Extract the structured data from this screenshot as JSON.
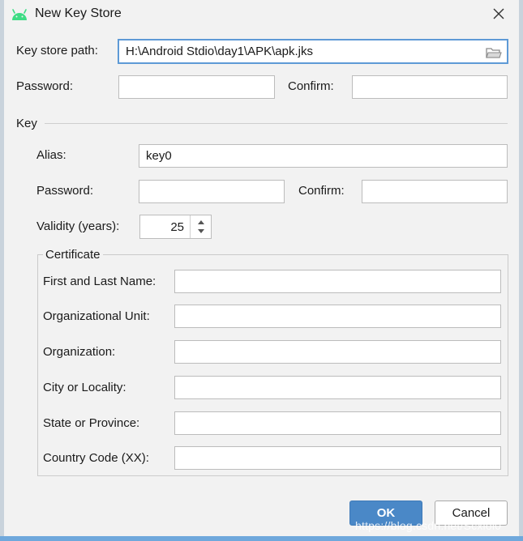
{
  "window": {
    "title": "New Key Store",
    "title_icon": "android-icon",
    "close_icon": "close-icon"
  },
  "keystore": {
    "path_label": "Key store path:",
    "path_value": "H:\\Android Stdio\\day1\\APK\\apk.jks",
    "folder_icon": "folder-icon",
    "password_label": "Password:",
    "password_value": "",
    "confirm_label": "Confirm:",
    "confirm_value": ""
  },
  "key": {
    "section_label": "Key",
    "alias_label": "Alias:",
    "alias_value": "key0",
    "password_label": "Password:",
    "password_value": "",
    "confirm_label": "Confirm:",
    "confirm_value": "",
    "validity_label": "Validity (years):",
    "validity_value": "25"
  },
  "certificate": {
    "group_label": "Certificate",
    "fields": [
      {
        "label": "First and Last Name:",
        "value": ""
      },
      {
        "label": "Organizational Unit:",
        "value": ""
      },
      {
        "label": "Organization:",
        "value": ""
      },
      {
        "label": "City or Locality:",
        "value": ""
      },
      {
        "label": "State or Province:",
        "value": ""
      },
      {
        "label": "Country Code (XX):",
        "value": ""
      }
    ]
  },
  "buttons": {
    "ok": "OK",
    "cancel": "Cancel"
  },
  "watermark": "https://blog.csdn.net/Scxioi0",
  "colors": {
    "accent": "#4a88c7",
    "android_green": "#3ddc84",
    "focus_border": "#5e9ad6"
  }
}
